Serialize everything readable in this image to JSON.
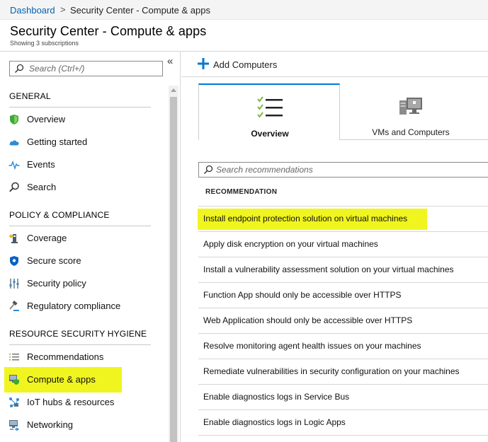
{
  "breadcrumb": {
    "root": "Dashboard",
    "separator": ">",
    "current": "Security Center - Compute & apps"
  },
  "header": {
    "title": "Security Center - Compute & apps",
    "subtitle": "Showing 3 subscriptions"
  },
  "sidebar": {
    "collapse_glyph": "«",
    "search_placeholder": "Search (Ctrl+/)",
    "sections": [
      {
        "title": "GENERAL",
        "items": [
          {
            "label": "Overview",
            "icon": "shield-icon"
          },
          {
            "label": "Getting started",
            "icon": "cloud-icon"
          },
          {
            "label": "Events",
            "icon": "pulse-icon"
          },
          {
            "label": "Search",
            "icon": "search-icon"
          }
        ]
      },
      {
        "title": "POLICY & COMPLIANCE",
        "items": [
          {
            "label": "Coverage",
            "icon": "coverage-icon"
          },
          {
            "label": "Secure score",
            "icon": "secure-score-icon"
          },
          {
            "label": "Security policy",
            "icon": "policy-sliders-icon"
          },
          {
            "label": "Regulatory compliance",
            "icon": "gavel-icon"
          }
        ]
      },
      {
        "title": "RESOURCE SECURITY HYGIENE",
        "items": [
          {
            "label": "Recommendations",
            "icon": "list-icon"
          },
          {
            "label": "Compute & apps",
            "icon": "compute-icon",
            "active": true
          },
          {
            "label": "IoT hubs & resources",
            "icon": "iot-icon"
          },
          {
            "label": "Networking",
            "icon": "network-icon"
          }
        ]
      }
    ]
  },
  "toolbar": {
    "add_label": "Add Computers"
  },
  "tabs": [
    {
      "label": "Overview",
      "icon": "checklist-icon",
      "selected": true
    },
    {
      "label": "VMs and Computers",
      "icon": "vm-computers-icon",
      "selected": false
    }
  ],
  "recommendations": {
    "search_placeholder": "Search recommendations",
    "column_header": "RECOMMENDATION",
    "rows": [
      "Install endpoint protection solution on virtual machines",
      "Apply disk encryption on your virtual machines",
      "Install a vulnerability assessment solution on your virtual machines",
      "Function App should only be accessible over HTTPS",
      "Web Application should only be accessible over HTTPS",
      "Resolve monitoring agent health issues on your machines",
      "Remediate vulnerabilities in security configuration on your machines",
      "Enable diagnostics logs in Service Bus",
      "Enable diagnostics logs in Logic Apps"
    ]
  },
  "colors": {
    "accent": "#0078d4",
    "link": "#0063b1",
    "highlight": "#f0f51f",
    "active_bg": "#dbeaf8"
  }
}
